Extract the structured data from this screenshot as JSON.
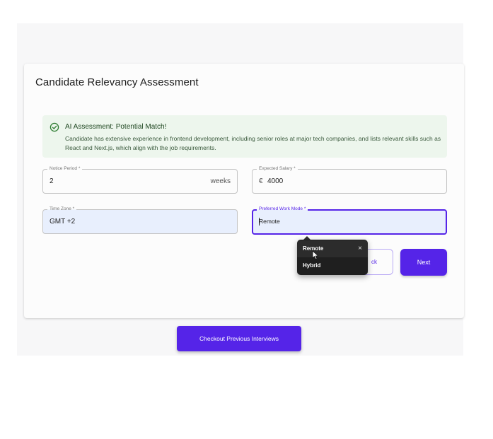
{
  "card": {
    "title": "Candidate Relevancy Assessment"
  },
  "alert": {
    "icon": "check-circle-icon",
    "title": "AI Assessment: Potential Match!",
    "body": "Candidate has extensive experience in frontend development, including senior roles at major tech companies, and lists relevant skills such as React and Next.js, which align with the job requirements.",
    "color": "#2e7d32"
  },
  "fields": {
    "notice_period": {
      "label": "Notice Period *",
      "value": "2",
      "unit": "weeks"
    },
    "expected_salary": {
      "label": "Expected Salary *",
      "prefix": "€",
      "value": "4000"
    },
    "time_zone": {
      "label": "Time Zone *",
      "value": "GMT +2"
    },
    "work_mode": {
      "label": "Preferred Work Mode *",
      "value": "Remote"
    }
  },
  "dropdown": {
    "options": [
      "Remote",
      "Hybrid"
    ],
    "highlighted": "Remote",
    "close_symbol": "×"
  },
  "buttons": {
    "back_label": "Back",
    "back_visible_label": "ck",
    "next_label": "Next",
    "checkout_label": "Checkout Previous Interviews"
  },
  "colors": {
    "accent": "#5524e8",
    "alert_bg": "#edf6ed"
  }
}
